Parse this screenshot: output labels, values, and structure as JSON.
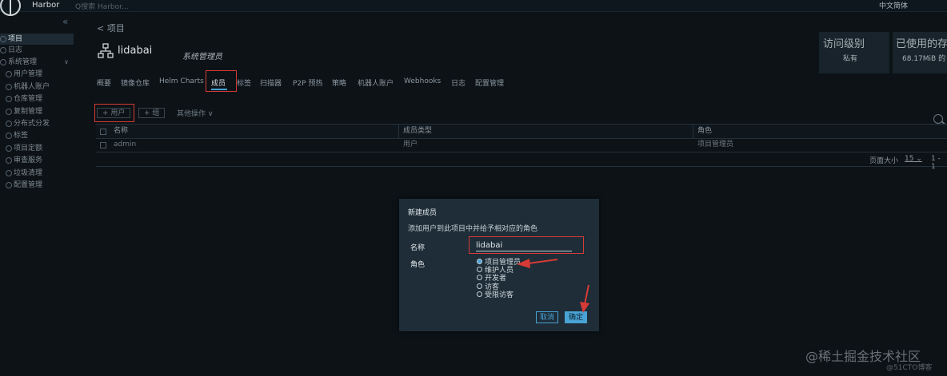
{
  "header": {
    "app_title": "Harbor",
    "search_placeholder": "Q搜索 Harbor...",
    "language": "中文简体"
  },
  "sidebar": {
    "items": [
      {
        "label": "项目",
        "active": true
      },
      {
        "label": "日志"
      },
      {
        "label": "系统管理",
        "expandable": true
      },
      {
        "label": "用户管理",
        "sub": true
      },
      {
        "label": "机器人账户",
        "sub": true
      },
      {
        "label": "仓库管理",
        "sub": true
      },
      {
        "label": "复制管理",
        "sub": true
      },
      {
        "label": "分布式分发",
        "sub": true
      },
      {
        "label": "标签",
        "sub": true
      },
      {
        "label": "项目定额",
        "sub": true
      },
      {
        "label": "审查服务",
        "sub": true
      },
      {
        "label": "垃圾清理",
        "sub": true
      },
      {
        "label": "配置管理",
        "sub": true
      }
    ]
  },
  "project": {
    "back_label": "< 项目",
    "name": "lidabai",
    "role": "系统管理员",
    "kpi": [
      {
        "title": "访问级别",
        "value": "私有"
      },
      {
        "title": "已使用的存",
        "value": "68.17MiB 的"
      }
    ],
    "tabs": [
      "概要",
      "镜像仓库",
      "Helm Charts",
      "成员",
      "标签",
      "扫描器",
      "P2P 预热",
      "策略",
      "机器人账户",
      "Webhooks",
      "日志",
      "配置管理"
    ],
    "active_tab": "成员"
  },
  "toolbar": {
    "add_user": "+ 用户",
    "add_group": "+ 组",
    "more_ops": "其他操作 ∨"
  },
  "table": {
    "columns": [
      "名称",
      "成员类型",
      "角色"
    ],
    "rows": [
      {
        "name": "admin",
        "type": "用户",
        "role": "项目管理员"
      }
    ],
    "footer": {
      "page_size_label": "页面大小",
      "page_size": "15 ⌄",
      "range": "1 - 1"
    }
  },
  "modal": {
    "title": "新建成员",
    "description": "添加用户到此项目中并给予相对应的角色",
    "name_label": "名称",
    "name_value": "lidabai",
    "role_label": "角色",
    "roles": [
      "项目管理员",
      "维护人员",
      "开发者",
      "访客",
      "受限访客"
    ],
    "selected_role": "项目管理员",
    "cancel": "取消",
    "ok": "确定"
  },
  "watermark": {
    "line1": "@稀土掘金技术社区",
    "line2": "@51CTO博客"
  },
  "colors": {
    "accent": "#49a3d4",
    "annotation": "#d63a36",
    "background": "#0c1216",
    "modal_bg": "#1e2d38"
  }
}
